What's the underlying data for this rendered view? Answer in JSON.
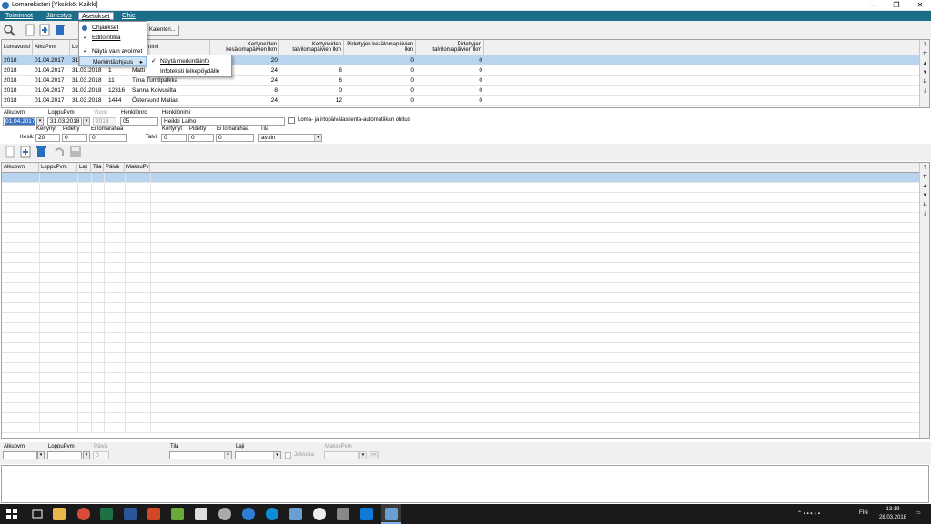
{
  "window": {
    "title": "Lomarekisteri [Yksikkö: Kaikki]",
    "minimize": "—",
    "restore": "❐",
    "close": "✕"
  },
  "menu": {
    "items": [
      "Toiminnot",
      "Järjestys",
      "Asetukset",
      "Ohje"
    ]
  },
  "toolbar": {
    "calendar_button": "Kalenteri..."
  },
  "asetukset_menu": {
    "items": [
      "Ohjaukset",
      "Editointitila",
      "Näytä vain avoimet",
      "Merkintäohjaus"
    ],
    "checked": [
      false,
      true,
      true,
      false
    ]
  },
  "merkinta_submenu": {
    "items": [
      "Näytä merkintäinfo",
      "Infoteksti leikepöydälle"
    ],
    "checked": [
      true,
      false
    ]
  },
  "top_grid": {
    "columns": [
      "Lomavuosi",
      "AlkuPvm",
      "Lo",
      "",
      "Henkilönimi",
      "Kertyneiden kesälomapäivien lkm",
      "Kertyneiden talvilomapäivien lkm",
      "Pidettyjen kesälomapäivien lkm",
      "Pidettyjen talvilomapäivien lkm"
    ],
    "header_visible": [
      "Lomavuosi",
      "AlkuPvm",
      "Lo",
      "nimi"
    ],
    "rows": [
      [
        "2018",
        "01.04.2017",
        "31",
        "",
        "",
        "20",
        "",
        "0",
        "0"
      ],
      [
        "2018",
        "01.04.2017",
        "31.03.2018",
        "1",
        "Matti",
        "24",
        "6",
        "0",
        "0"
      ],
      [
        "2018",
        "01.04.2017",
        "31.03.2018",
        "11",
        "Tiina Tunttipalkka",
        "24",
        "6",
        "0",
        "0"
      ],
      [
        "2018",
        "01.04.2017",
        "31.03.2018",
        "12316",
        "Sanna Koivusilta",
        "8",
        "0",
        "0",
        "0"
      ],
      [
        "2018",
        "01.04.2017",
        "31.03.2018",
        "1444",
        "Östersund Matias",
        "24",
        "12",
        "0",
        "0"
      ]
    ]
  },
  "form": {
    "alkupvm_label": "Alkupvm",
    "alkupvm_value": "01.04.2017",
    "loppupvm_label": "LoppuPvm",
    "loppupvm_value": "31.03.2018",
    "vuosi_label": "Vuosi",
    "vuosi_value": "2018",
    "henkilonro_label": "Henkilönro",
    "henkilonro_value": "05",
    "henkilonimi_label": "Henkilönimi",
    "henkilonimi_value": "Heikki Laiho",
    "auto_check_label": "Loma- ja irtopäivälaskenta-automatiikan ohitus",
    "kertynyt_label": "Kertynyt",
    "pidetty_label": "Pidetty",
    "ei_lomarahaa_label": "Ei lomarahaa",
    "kesa_label": "Kesä:",
    "kesa_kertynyt": "20",
    "kesa_pidetty": "0",
    "kesa_ei_lomarahaa": "0",
    "talvi_label": "Talvi:",
    "talvi_kertynyt": "0",
    "talvi_pidetty": "0",
    "talvi_ei_lomarahaa": "0",
    "tila_label": "Tila",
    "tila_value": "avoin"
  },
  "detail_grid": {
    "columns": [
      "Alkupvm",
      "LoppuPvm",
      "Laji",
      "Tila",
      "Päivä",
      "MaksuPv"
    ]
  },
  "filter": {
    "alkupvm_label": "Alkupvm",
    "loppupvm_label": "LoppuPvm",
    "paiva_label": "Päivä",
    "paiva_value": "0",
    "tila_label": "Tila",
    "laji_label": "Laji",
    "jaksolla_label": "Jaksolla",
    "maksupvm_label": "MaksuPvm",
    "go_label": ">>"
  },
  "taskbar": {
    "language": "FIN",
    "time": "13:19",
    "date": "28.03.2018"
  },
  "colors": {
    "menubar": "#1a6e8a",
    "selected_row": "#b8d4ee",
    "highlight": "#d0e4f7"
  }
}
